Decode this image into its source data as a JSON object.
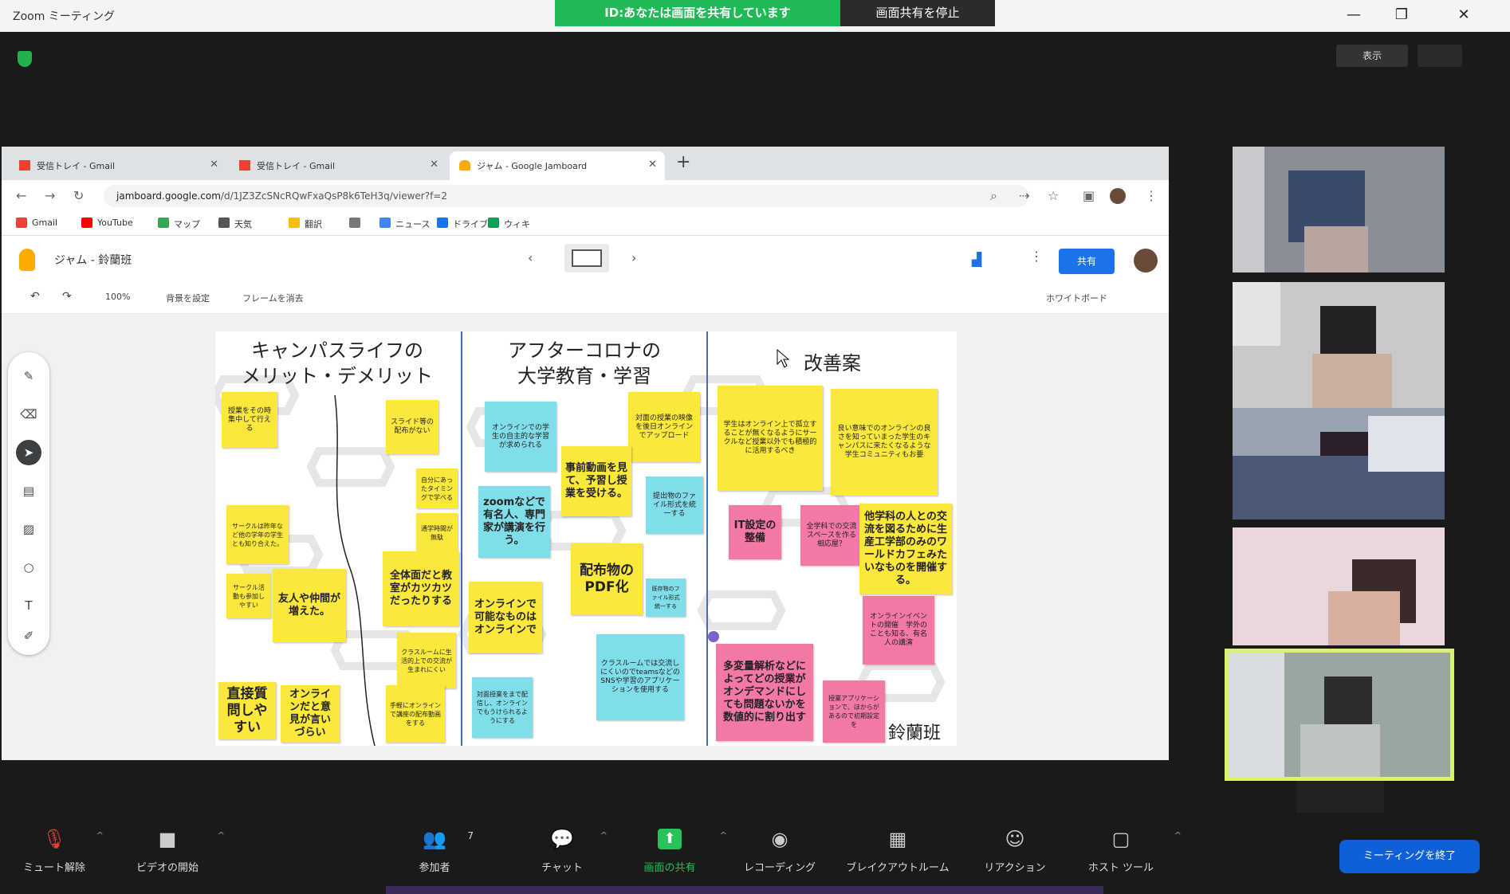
{
  "zoom": {
    "window_title": "Zoom ミーティング",
    "share_banner": "ID:あなたは画面を共有しています",
    "share_options": "画面共有を停止",
    "minimize": "—",
    "maximize": "❐",
    "close": "✕",
    "view_label": "表示"
  },
  "browser": {
    "tabs": [
      {
        "label": "受信トレイ - Gmail",
        "icon_color": "#ea4335"
      },
      {
        "label": "受信トレイ - Gmail",
        "icon_color": "#ea4335"
      },
      {
        "label": "ジャム - Google Jamboard",
        "icon_color": "#f9ab00"
      }
    ],
    "url_host": "jamboard.google.com",
    "url_rest": "/d/1JZ3ZcSNcRQwFxaQsP8k6TeH3q/viewer?f=2",
    "bookmarks": [
      {
        "label": "Gmail",
        "color": "#ea4335"
      },
      {
        "label": "YouTube",
        "color": "#ff0000"
      },
      {
        "label": "マップ",
        "color": "#34a853"
      },
      {
        "label": "天気",
        "color": "#555555"
      },
      {
        "label": "翻訳",
        "color": "#fbbc04"
      },
      {
        "label": "",
        "color": "#777777"
      },
      {
        "label": "ニュース",
        "color": "#4285f4"
      },
      {
        "label": "ドライブ",
        "color": "#1a73e8"
      },
      {
        "label": "ウィキ",
        "color": "#0f9d58"
      }
    ]
  },
  "jamboard": {
    "title": "ジャム - 鈴蘭班",
    "share_label": "共有",
    "toolbar": {
      "undo": "↶",
      "redo": "↷",
      "zoom": "100%",
      "background": "背景を設定",
      "clear": "フレームを消去"
    },
    "right_label": "ホワイトボード",
    "columns": [
      {
        "title": "キャンパスライフの\nメリット・デメリット"
      },
      {
        "title": "アフターコロナの\n大学教育・学習"
      },
      {
        "title": "改善案"
      }
    ],
    "group_name": "鈴蘭班",
    "notes": [
      {
        "text": "授業をその時集中して行える"
      },
      {
        "text": "スライド等の配布がない"
      },
      {
        "text": "自分にあったタイミングで学べる"
      },
      {
        "text": "通学時間が無駄"
      },
      {
        "text": "サークルは昨年など他の学年の学生とも知り合えた。"
      },
      {
        "text": "サークル活動も参加しやすい"
      },
      {
        "text": "友人や仲間が増えた。"
      },
      {
        "text": "全体面だと教室がカツカツだったりする"
      },
      {
        "text": "クラスルームに生活的上での交流が生まれにくい"
      },
      {
        "text": "直接質問しやすい"
      },
      {
        "text": "オンラインだと意見が言いづらい"
      },
      {
        "text": "手軽にオンラインで講座の配布動画をする"
      },
      {
        "text": "オンラインでの学生の自主的な学習が求められる"
      },
      {
        "text": "対面の授業の映像を後日オンラインでアップロード"
      },
      {
        "text": "事前動画を見て、予習し授業を受ける。"
      },
      {
        "text": "提出物のファイル形式を統一する"
      },
      {
        "text": "zoomなどで有名人、専門家が講演を行う。"
      },
      {
        "text": "配布物のPDF化"
      },
      {
        "text": "既存物のファイル形式統一する"
      },
      {
        "text": "オンラインで可能なものはオンラインで"
      },
      {
        "text": "クラスルームでは交流しにくいのでteamsなどのSNSや学習のアプリケーションを使用する"
      },
      {
        "text": "対面授業をまで配信し、オンラインでもうけられるようにする"
      },
      {
        "text": "学生はオンライン上で孤立することが無くなるようにサークルなど授業以外でも積極的に活用するべき"
      },
      {
        "text": "良い意味でのオンラインの良さを知っていまった学生のキャンパスに来たくなるような学生コミュニティもお要"
      },
      {
        "text": "IT設定の整備"
      },
      {
        "text": "全学科での交流スペースを作る相応屋？"
      },
      {
        "text": "他学科の人との交流を図るために生産工学部のみのワールドカフェみたいなものを開催する。"
      },
      {
        "text": "オンラインイベントの開催　学外のことも知る、有名人の講演"
      },
      {
        "text": "多変量解析などによってどの授業がオンデマンドにしても問題ないかを数値的に割り出す"
      },
      {
        "text": "授業アプリケーションで、ほからがあるので初期設定を"
      }
    ]
  },
  "toolbar": {
    "mute": "ミュート解除",
    "video": "ビデオの開始",
    "participants": "参加者",
    "participants_count": "7",
    "chat": "チャット",
    "share": "画面の共有",
    "record": "レコーディング",
    "breakout": "ブレイクアウトルーム",
    "reactions": "リアクション",
    "more": "ホスト ツール",
    "end": "ミーティングを終了"
  }
}
